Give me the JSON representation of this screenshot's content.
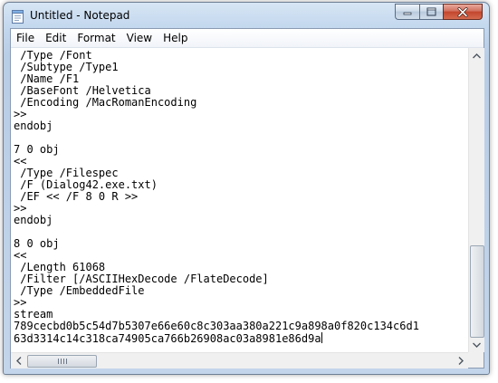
{
  "window": {
    "title": "Untitled - Notepad",
    "app_icon": "notepad-icon",
    "accent_color": "#c2452c"
  },
  "caption_buttons": {
    "minimize_icon": "minimize-icon",
    "maximize_icon": "maximize-icon",
    "close_icon": "close-icon"
  },
  "menu": [
    "File",
    "Edit",
    "Format",
    "View",
    "Help"
  ],
  "editor": {
    "lines": [
      " /Type /Font",
      " /Subtype /Type1",
      " /Name /F1",
      " /BaseFont /Helvetica",
      " /Encoding /MacRomanEncoding",
      ">>",
      "endobj",
      "",
      "7 0 obj",
      "<<",
      " /Type /Filespec",
      " /F (Dialog42.exe.txt)",
      " /EF << /F 8 0 R >>",
      ">>",
      "endobj",
      "",
      "8 0 obj",
      "<<",
      " /Length 61068",
      " /Filter [/ASCIIHexDecode /FlateDecode]",
      " /Type /EmbeddedFile",
      ">>",
      "stream",
      "789cecbd0b5c54d7b5307e66e60c8c303aa380a221c9a898a0f820c134c6d1",
      "63d3314c14c318ca74905ca766b26908ac03a8981e86d9a"
    ]
  },
  "scrollbars": {
    "vertical_position": 0.72,
    "horizontal_position": 0.0
  }
}
